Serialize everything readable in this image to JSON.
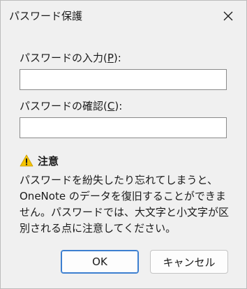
{
  "dialog": {
    "title": "パスワード保護",
    "close_icon": "close-icon"
  },
  "password_field": {
    "label_before": "パスワードの入力(",
    "accesskey": "P",
    "label_after": "):",
    "value": ""
  },
  "confirm_field": {
    "label_before": "パスワードの確認(",
    "accesskey": "C",
    "label_after": "):",
    "value": ""
  },
  "warning": {
    "icon": "warning-icon",
    "title": "注意",
    "body": "パスワードを紛失したり忘れてしまうと、OneNote のデータを復旧することができません。パスワードでは、大文字と小文字が区別される点に注意してください。"
  },
  "buttons": {
    "ok_label": "OK",
    "cancel_label": "キャンセル"
  },
  "colors": {
    "warning_yellow": "#f5c400",
    "accent_border": "#3c7fd0"
  }
}
